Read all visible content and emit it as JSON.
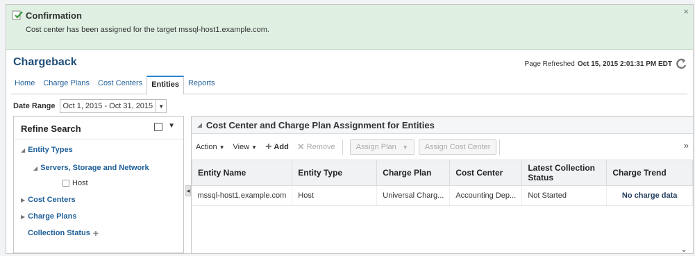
{
  "confirmation": {
    "title": "Confirmation",
    "message": "Cost center has been assigned for the target mssql-host1.example.com.",
    "close": "×"
  },
  "header": {
    "title": "Chargeback",
    "refreshed_label": "Page Refreshed",
    "refreshed_time": "Oct 15, 2015 2:01:31 PM EDT"
  },
  "tabs": [
    "Home",
    "Charge Plans",
    "Cost Centers",
    "Entities",
    "Reports"
  ],
  "active_tab": "Entities",
  "date_range": {
    "label": "Date Range",
    "value": "Oct 1, 2015 - Oct 31, 2015"
  },
  "refine": {
    "title": "Refine Search",
    "entity_types": "Entity Types",
    "servers": "Servers, Storage and Network",
    "host": "Host",
    "cost_centers": "Cost Centers",
    "charge_plans": "Charge Plans",
    "collection_status": "Collection Status"
  },
  "panel": {
    "title": "Cost Center and Charge Plan Assignment for Entities"
  },
  "toolbar": {
    "action": "Action",
    "view": "View",
    "add": "Add",
    "remove": "Remove",
    "assign_plan": "Assign Plan",
    "assign_cost_center": "Assign Cost Center"
  },
  "table": {
    "columns": [
      "Entity Name",
      "Entity Type",
      "Charge Plan",
      "Cost Center",
      "Latest Collection Status",
      "Charge Trend"
    ],
    "rows": [
      [
        "mssql-host1.example.com",
        "Host",
        "Universal Charg...",
        "Accounting Dep...",
        "Not Started",
        "No charge data"
      ]
    ]
  },
  "colors": {
    "accent": "#2c84d1",
    "link": "#1f5f99",
    "banner": "#dff0e3",
    "title": "#1f4e79"
  }
}
